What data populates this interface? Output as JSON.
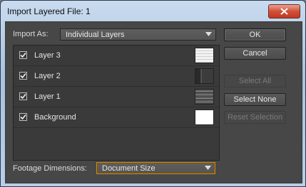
{
  "window": {
    "title": "Import Layered File: 1"
  },
  "import_as": {
    "label": "Import As:",
    "value": "Individual Layers"
  },
  "layers": [
    {
      "name": "Layer 3",
      "checked": true
    },
    {
      "name": "Layer 2",
      "checked": true
    },
    {
      "name": "Layer 1",
      "checked": true
    },
    {
      "name": "Background",
      "checked": true
    }
  ],
  "buttons": {
    "ok": "OK",
    "cancel": "Cancel",
    "select_all": "Select All",
    "select_none": "Select None",
    "reset_selection": "Reset Selection"
  },
  "footage": {
    "label": "Footage Dimensions:",
    "value": "Document Size"
  },
  "colors": {
    "dialog_bg": "#474747",
    "highlight_border": "#c98a1a",
    "close_red": "#c13a23"
  },
  "icons": {
    "close": "close-icon",
    "dropdown": "chevron-down-icon",
    "check": "check-icon"
  }
}
